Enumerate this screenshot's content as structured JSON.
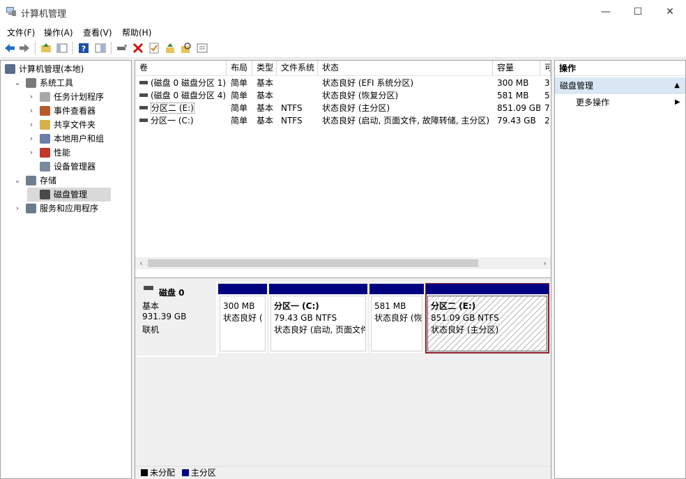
{
  "window": {
    "title": "计算机管理",
    "minimize": "—",
    "maximize": "☐",
    "close": "✕"
  },
  "menu": [
    "文件(F)",
    "操作(A)",
    "查看(V)",
    "帮助(H)"
  ],
  "toolbar": {
    "icons": [
      "back-icon",
      "forward-icon",
      "up-folder-icon",
      "show-hide-tree-icon",
      "help-icon",
      "view-icon",
      "connect-drive-icon",
      "delete-icon",
      "properties-icon",
      "export-icon",
      "search-icon",
      "list-icon"
    ],
    "colors": {
      "back": "#1f6fc4",
      "delete": "#d01010",
      "help": "#1c4fa8"
    }
  },
  "tree": {
    "items": [
      {
        "label": "计算机管理(本地)",
        "level": 0,
        "chevron": "",
        "icon": "computer-management-icon",
        "color": "#5a6e8c"
      },
      {
        "label": "系统工具",
        "level": 1,
        "chevron": "⌄",
        "icon": "tools-icon",
        "color": "#7a7a7a"
      },
      {
        "label": "任务计划程序",
        "level": 2,
        "chevron": "›",
        "icon": "clock-icon",
        "color": "#a8a8a8"
      },
      {
        "label": "事件查看器",
        "level": 2,
        "chevron": "›",
        "icon": "event-viewer-icon",
        "color": "#b65a2c"
      },
      {
        "label": "共享文件夹",
        "level": 2,
        "chevron": "›",
        "icon": "shared-folder-icon",
        "color": "#d6b04a"
      },
      {
        "label": "本地用户和组",
        "level": 2,
        "chevron": "›",
        "icon": "users-icon",
        "color": "#6a7fa5"
      },
      {
        "label": "性能",
        "level": 2,
        "chevron": "›",
        "icon": "performance-icon",
        "color": "#c0392b"
      },
      {
        "label": "设备管理器",
        "level": 2,
        "chevron": "",
        "icon": "device-manager-icon",
        "color": "#7a8a9e"
      },
      {
        "label": "存储",
        "level": 1,
        "chevron": "⌄",
        "icon": "storage-icon",
        "color": "#6f7f8f"
      },
      {
        "label": "磁盘管理",
        "level": 2,
        "chevron": "",
        "icon": "disk-management-icon",
        "color": "#4a4a4a"
      },
      {
        "label": "服务和应用程序",
        "level": 1,
        "chevron": "›",
        "icon": "services-icon",
        "color": "#6b7b8b"
      }
    ]
  },
  "volumes": {
    "columns": [
      "卷",
      "布局",
      "类型",
      "文件系统",
      "状态",
      "容量",
      "可"
    ],
    "rows": [
      {
        "name": "(磁盘 0 磁盘分区 1)",
        "layout": "简单",
        "type": "基本",
        "fs": "",
        "status": "状态良好 (EFI 系统分区)",
        "capacity": "300 MB",
        "free": "3"
      },
      {
        "name": "(磁盘 0 磁盘分区 4)",
        "layout": "简单",
        "type": "基本",
        "fs": "",
        "status": "状态良好 (恢复分区)",
        "capacity": "581 MB",
        "free": "5"
      },
      {
        "name": "分区二 (E:)",
        "layout": "简单",
        "type": "基本",
        "fs": "NTFS",
        "status": "状态良好 (主分区)",
        "capacity": "851.09 GB",
        "free": "7"
      },
      {
        "name": "分区一 (C:)",
        "layout": "简单",
        "type": "基本",
        "fs": "NTFS",
        "status": "状态良好 (启动, 页面文件, 故障转储, 主分区)",
        "capacity": "79.43 GB",
        "free": "2"
      }
    ],
    "scroll_left": "‹",
    "scroll_right": "›"
  },
  "disk": {
    "name": "磁盘 0",
    "type": "基本",
    "size": "931.39 GB",
    "state": "联机",
    "partitions": [
      {
        "title": "",
        "size": "300 MB",
        "status": "状态良好 ("
      },
      {
        "title": "分区一 (C:)",
        "size": "79.43 GB NTFS",
        "status": "状态良好 (启动, 页面文件"
      },
      {
        "title": "",
        "size": "581 MB",
        "status": "状态良好 (恢"
      },
      {
        "title": "分区二 (E:)",
        "size": "851.09 GB NTFS",
        "status": "状态良好 (主分区)"
      }
    ]
  },
  "legend": {
    "unallocated": "未分配",
    "primary": "主分区",
    "unallocated_color": "#000000",
    "primary_color": "#000080"
  },
  "actions": {
    "header": "操作",
    "selected": "磁盘管理",
    "selected_arrow": "▲",
    "more": "更多操作",
    "more_arrow": "▶"
  }
}
